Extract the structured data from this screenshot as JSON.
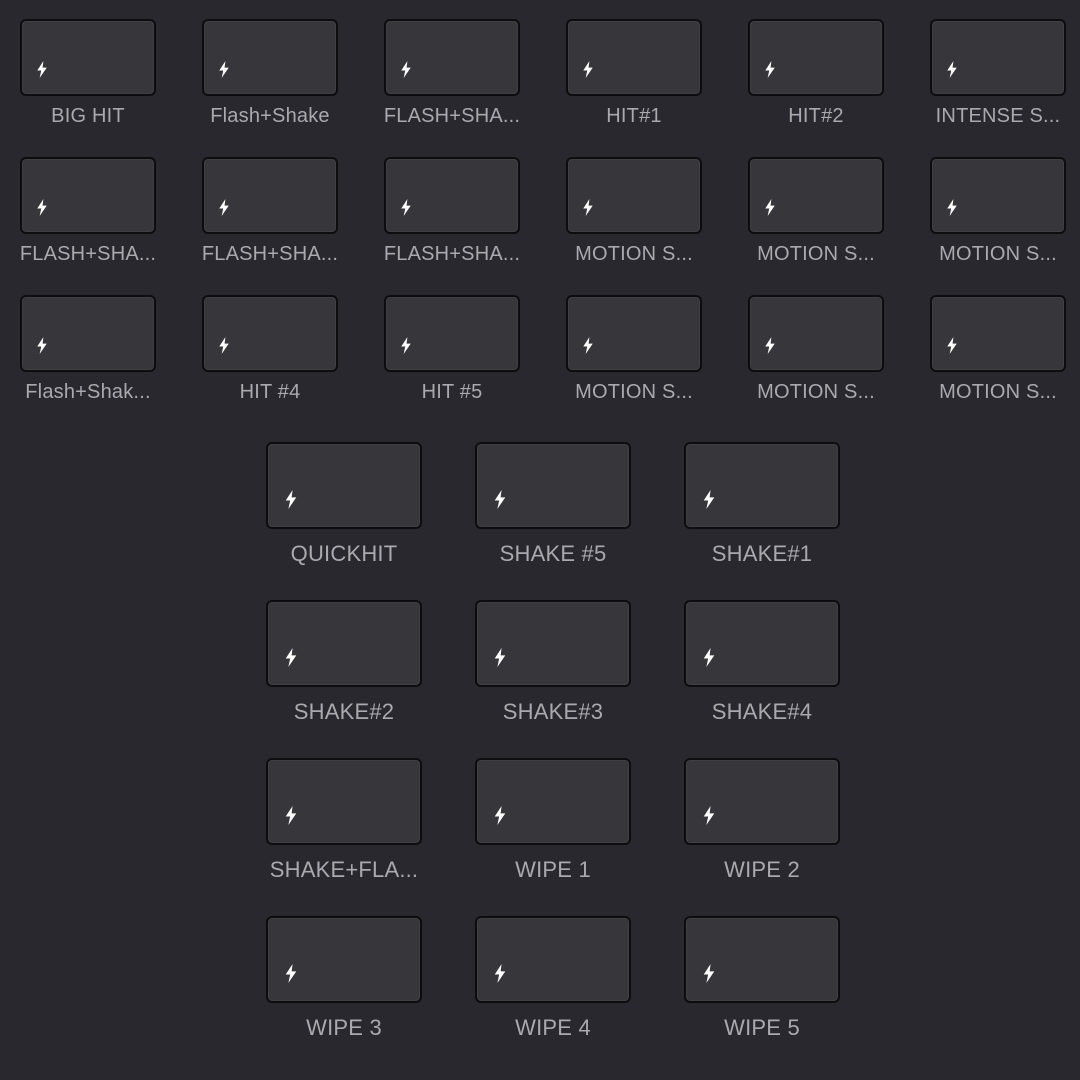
{
  "top_grid": {
    "clips": [
      {
        "label": "BIG HIT",
        "icon": "lightning-bolt-icon"
      },
      {
        "label": "Flash+Shake",
        "icon": "lightning-bolt-icon"
      },
      {
        "label": "FLASH+SHA...",
        "icon": "lightning-bolt-icon"
      },
      {
        "label": "HIT#1",
        "icon": "lightning-bolt-icon"
      },
      {
        "label": "HIT#2",
        "icon": "lightning-bolt-icon"
      },
      {
        "label": "INTENSE S...",
        "icon": "lightning-bolt-icon"
      },
      {
        "label": "FLASH+SHA...",
        "icon": "lightning-bolt-icon"
      },
      {
        "label": "FLASH+SHA...",
        "icon": "lightning-bolt-icon"
      },
      {
        "label": "FLASH+SHA...",
        "icon": "lightning-bolt-icon"
      },
      {
        "label": "MOTION S...",
        "icon": "lightning-bolt-icon"
      },
      {
        "label": "MOTION S...",
        "icon": "lightning-bolt-icon"
      },
      {
        "label": "MOTION S...",
        "icon": "lightning-bolt-icon"
      },
      {
        "label": "Flash+Shak...",
        "icon": "lightning-bolt-icon"
      },
      {
        "label": "HIT #4",
        "icon": "lightning-bolt-icon"
      },
      {
        "label": "HIT #5",
        "icon": "lightning-bolt-icon"
      },
      {
        "label": "MOTION S...",
        "icon": "lightning-bolt-icon"
      },
      {
        "label": "MOTION S...",
        "icon": "lightning-bolt-icon"
      },
      {
        "label": "MOTION S...",
        "icon": "lightning-bolt-icon"
      }
    ]
  },
  "bottom_grid": {
    "clips": [
      {
        "label": "QUICKHIT",
        "icon": "lightning-bolt-icon"
      },
      {
        "label": "SHAKE #5",
        "icon": "lightning-bolt-icon"
      },
      {
        "label": "SHAKE#1",
        "icon": "lightning-bolt-icon"
      },
      {
        "label": "SHAKE#2",
        "icon": "lightning-bolt-icon"
      },
      {
        "label": "SHAKE#3",
        "icon": "lightning-bolt-icon"
      },
      {
        "label": "SHAKE#4",
        "icon": "lightning-bolt-icon"
      },
      {
        "label": "SHAKE+FLA...",
        "icon": "lightning-bolt-icon"
      },
      {
        "label": "WIPE 1",
        "icon": "lightning-bolt-icon"
      },
      {
        "label": "WIPE 2",
        "icon": "lightning-bolt-icon"
      },
      {
        "label": "WIPE 3",
        "icon": "lightning-bolt-icon"
      },
      {
        "label": "WIPE 4",
        "icon": "lightning-bolt-icon"
      },
      {
        "label": "WIPE 5",
        "icon": "lightning-bolt-icon"
      }
    ]
  },
  "colors": {
    "background": "#28282e",
    "thumbnail": "#36363b",
    "thumbnail_border": "#0d0d10",
    "label_text": "#a9a9ae",
    "icon": "#ffffff"
  }
}
